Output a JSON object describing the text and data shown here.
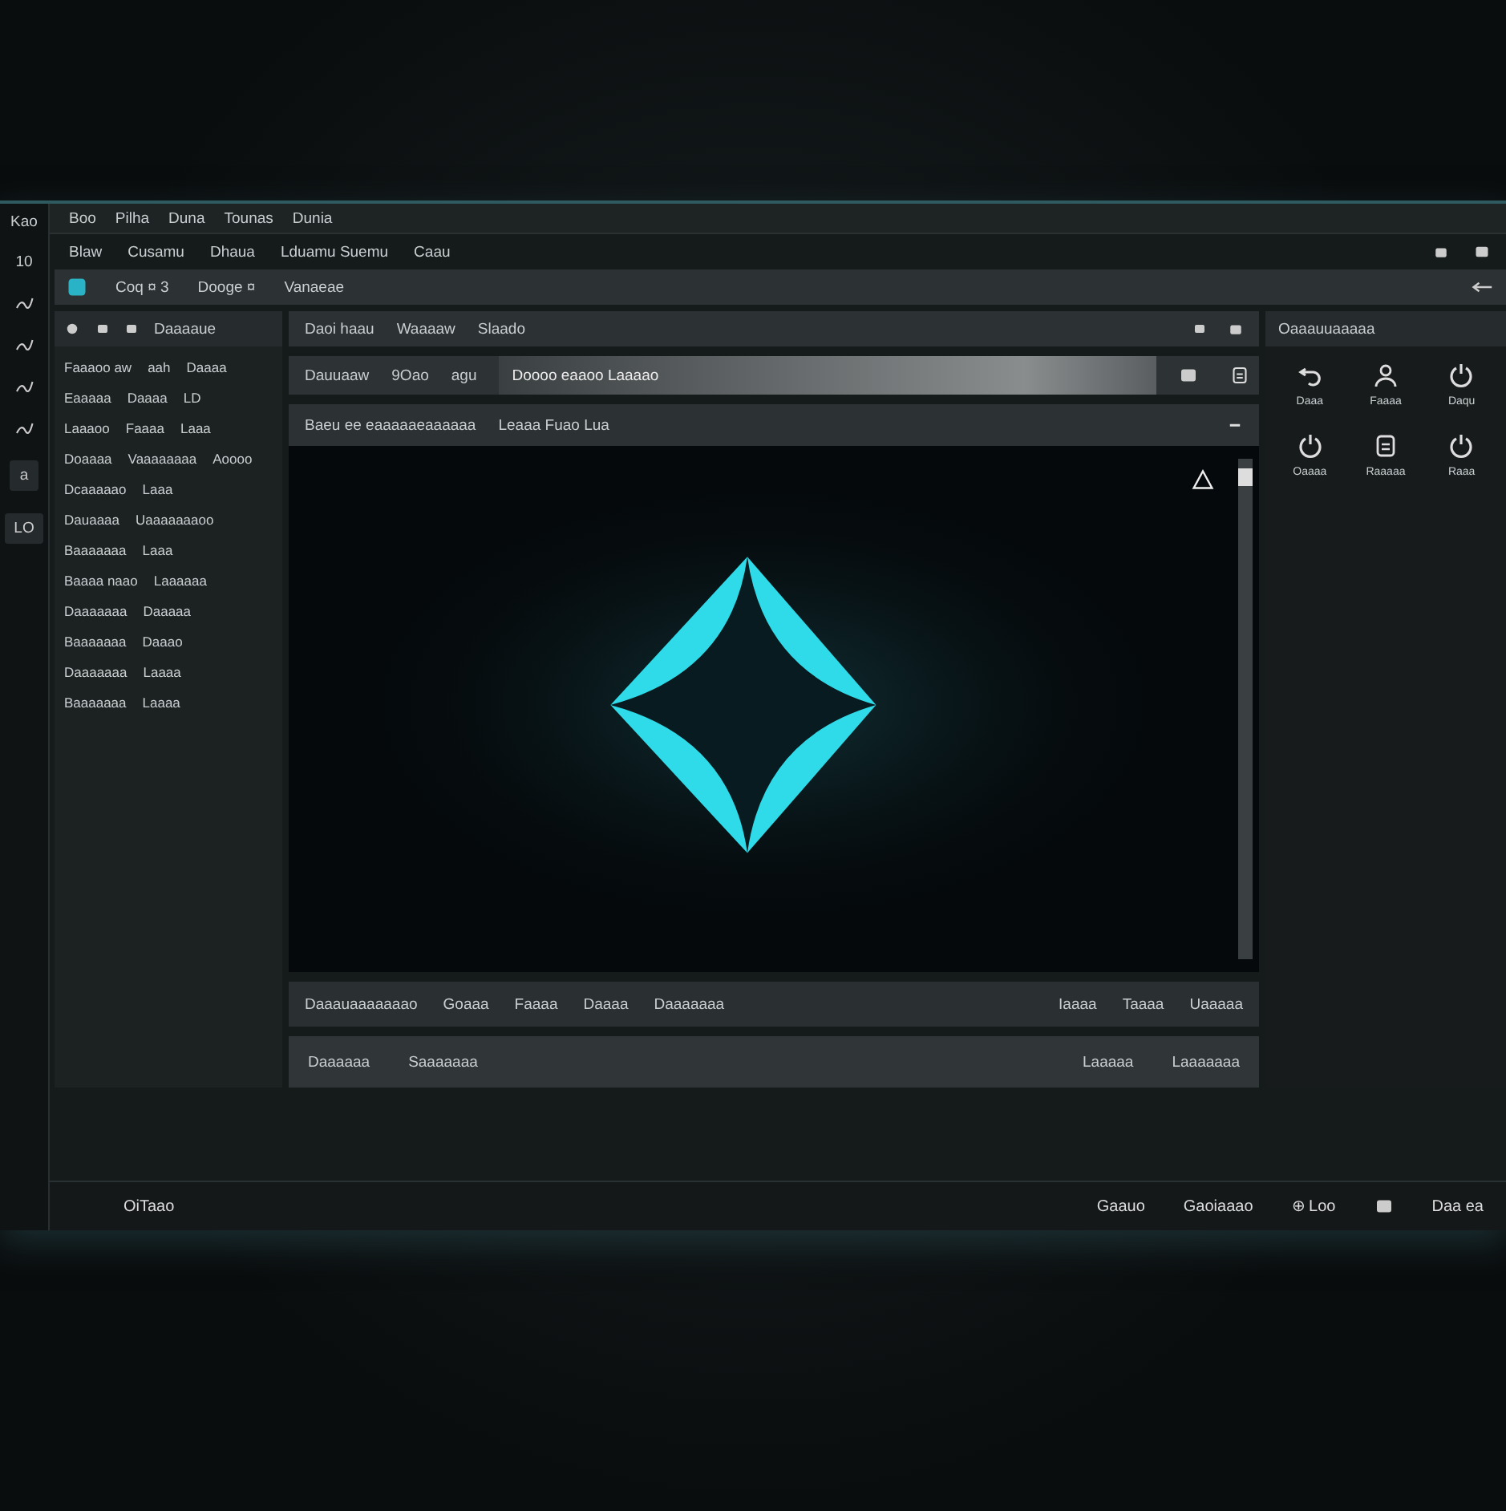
{
  "side_strip": [
    {
      "kind": "text",
      "label": "Kao"
    },
    {
      "kind": "text",
      "label": "10"
    },
    {
      "kind": "icon"
    },
    {
      "kind": "icon"
    },
    {
      "kind": "icon"
    },
    {
      "kind": "icon"
    },
    {
      "kind": "button",
      "label": "a"
    },
    {
      "kind": "button",
      "label": "LO"
    }
  ],
  "menu": [
    "Boo",
    "Pilha",
    "Duna",
    "Tounas",
    "Dunia"
  ],
  "submenu": [
    "Blaw",
    "Cusamu",
    "Dhaua",
    "Lduamu Suemu",
    "Caau"
  ],
  "toolbar": [
    "Coq ¤ 3",
    "Dooge ¤",
    "Vanaeae"
  ],
  "left_panel": {
    "title": "Daaaaue",
    "rows": [
      [
        "Faaaoo aw",
        "aah",
        "Daaaa"
      ],
      [
        "Eaaaaa",
        "Daaaa",
        "LD"
      ],
      [
        "Laaaoo",
        "Faaaa",
        "Laaa"
      ],
      [
        "Doaaaa",
        "Vaaaaaaaa",
        "Aoooo"
      ],
      [
        "Dcaaaaao",
        "Laaa"
      ],
      [
        "Dauaaaa",
        "Uaaaaaaaoo"
      ],
      [
        "Baaaaaaa",
        "Laaa"
      ],
      [
        "Baaaa naao",
        "Laaaaaa"
      ],
      [
        "Daaaaaaa",
        "Daaaaa"
      ],
      [
        "Baaaaaaa",
        "Daaao"
      ],
      [
        "Daaaaaaa",
        "Laaaa"
      ],
      [
        "Baaaaaaa",
        "Laaaa"
      ]
    ]
  },
  "center": {
    "tabs": [
      {
        "label": "Daoi haau",
        "selected": false
      },
      {
        "label": "Waaaaw",
        "selected": false
      },
      {
        "label": "Slaado",
        "selected": false
      }
    ],
    "field_labels": [
      "Dauuaaw",
      "9Oao",
      "agu"
    ],
    "field": {
      "value": "Doooo eaaoo Laaaao"
    },
    "panel_title": "Baeu ee eaaaaaeaaaaaa",
    "panel_info": "Leaaa Fuao Lua",
    "bottom_tabs": [
      "Daaauaaaaaaao",
      "Goaaa",
      "Faaaa",
      "Daaaa",
      "Daaaaaaa"
    ],
    "bottom_right": [
      "Iaaaa",
      "Taaaa",
      "Uaaaaa"
    ],
    "footer_left": [
      "Daaaaaa",
      "Saaaaaaa"
    ],
    "footer_right": [
      "Laaaaa",
      "Laaaaaaa"
    ]
  },
  "right_panel": {
    "title": "Oaaauuaaaaa",
    "tiles": [
      {
        "kind": "undo",
        "label": "Daaa"
      },
      {
        "kind": "user",
        "label": "Faaaa"
      },
      {
        "kind": "power",
        "label": "Daqu"
      },
      {
        "kind": "power",
        "label": "Oaaaa"
      },
      {
        "kind": "doc",
        "label": "Raaaaa"
      },
      {
        "kind": "power",
        "label": "Raaa"
      }
    ]
  },
  "status_bar": {
    "left": "OiTaao",
    "right": [
      "Gaauo",
      "Gaoiaaao",
      "⊕ Loo"
    ],
    "end": "Daa ea"
  }
}
